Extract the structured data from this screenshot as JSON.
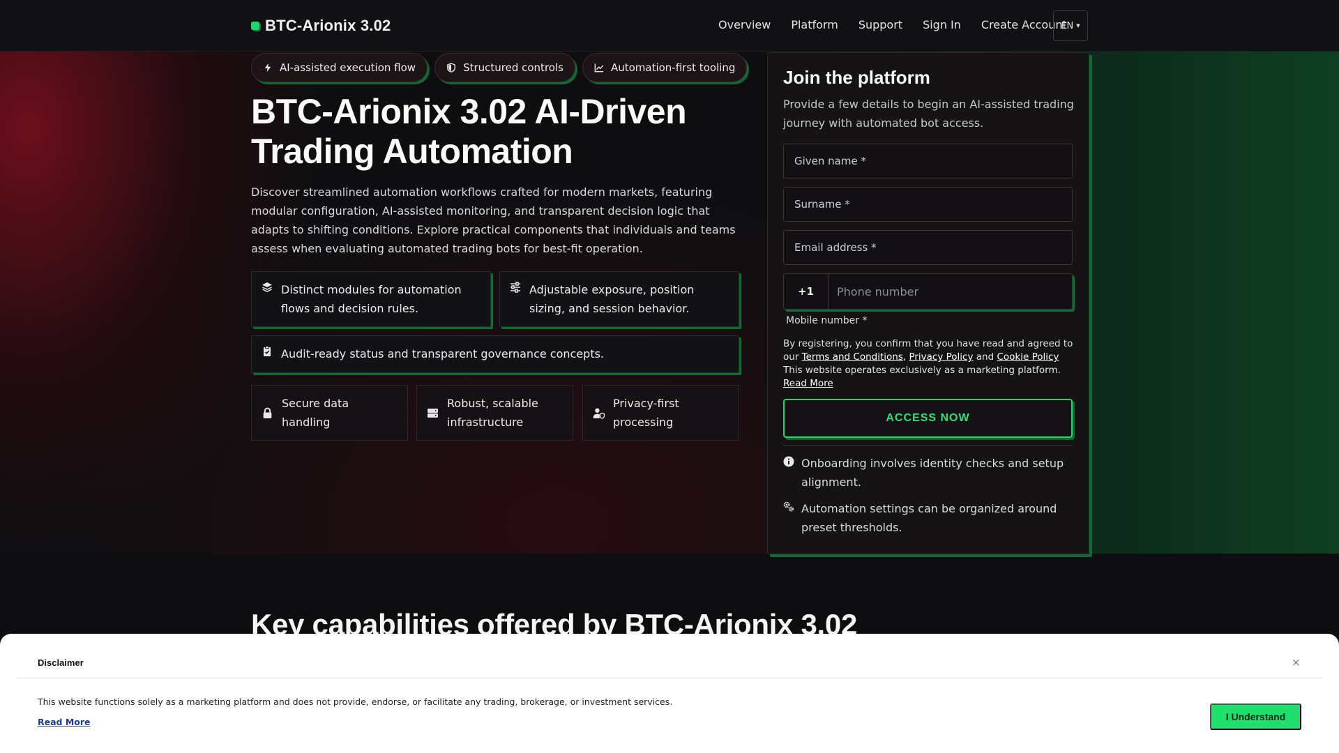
{
  "header": {
    "logo_text": "BTC-Arionix 3.02",
    "nav": [
      "Overview",
      "Platform",
      "Support",
      "Sign In",
      "Create Account"
    ],
    "language": "EN"
  },
  "tags": [
    {
      "label": "AI-assisted execution flow",
      "icon": "bolt-icon"
    },
    {
      "label": "Structured controls",
      "icon": "shield-icon"
    },
    {
      "label": "Automation-first tooling",
      "icon": "chart-line-icon"
    }
  ],
  "hero": {
    "title": "BTC-Arionix 3.02 AI-Driven Trading Automation",
    "description": "Discover streamlined automation workflows crafted for modern markets, featuring modular configuration, AI-assisted monitoring, and transparent decision logic that adapts to shifting conditions. Explore practical components that individuals and teams assess when evaluating automated trading bots for best-fit operation."
  },
  "features": [
    {
      "text": "Distinct modules for automation flows and decision rules.",
      "icon": "layers-icon"
    },
    {
      "text": "Adjustable exposure, position sizing, and session behavior.",
      "icon": "sliders-icon"
    },
    {
      "text": "Audit-ready status and transparent governance concepts.",
      "icon": "clipboard-check-icon"
    }
  ],
  "mini_features": [
    {
      "text": "Secure data handling",
      "icon": "lock-icon"
    },
    {
      "text": "Robust, scalable infrastructure",
      "icon": "server-icon"
    },
    {
      "text": "Privacy-first processing",
      "icon": "user-shield-icon"
    }
  ],
  "form": {
    "title": "Join the platform",
    "subtitle": "Provide a few details to begin an AI-assisted trading journey with automated bot access.",
    "given_name_placeholder": "Given name *",
    "surname_placeholder": "Surname *",
    "email_placeholder": "Email address *",
    "phone_code": "+1",
    "phone_placeholder": "Phone number",
    "phone_label": "Mobile number *",
    "legal_prefix": "By registering, you confirm that you have read and agreed to our",
    "terms_link": "Terms and Conditions",
    "privacy_link": "Privacy Policy",
    "and_text": "and",
    "cookie_link": "Cookie Policy",
    "legal_suffix": "This website operates exclusively as a marketing platform.",
    "read_more": "Read More",
    "submit_label": "ACCESS NOW",
    "info": [
      {
        "text": "Onboarding involves identity checks and setup alignment.",
        "icon": "info-icon"
      },
      {
        "text": "Automation settings can be organized around preset thresholds.",
        "icon": "gears-icon"
      }
    ]
  },
  "capabilities_title": "Key capabilities offered by BTC-Arionix 3.02",
  "disclaimer": {
    "title": "Disclaimer",
    "text": "This website functions solely as a marketing platform and does not provide, endorse, or facilitate any trading, brokerage, or investment services.",
    "read_more": "Read More",
    "button": "I Understand",
    "close_symbol": "×"
  },
  "colors": {
    "accent_green": "#21d46b",
    "shadow_green": "#0f6a33",
    "background": "#0e0e10"
  }
}
